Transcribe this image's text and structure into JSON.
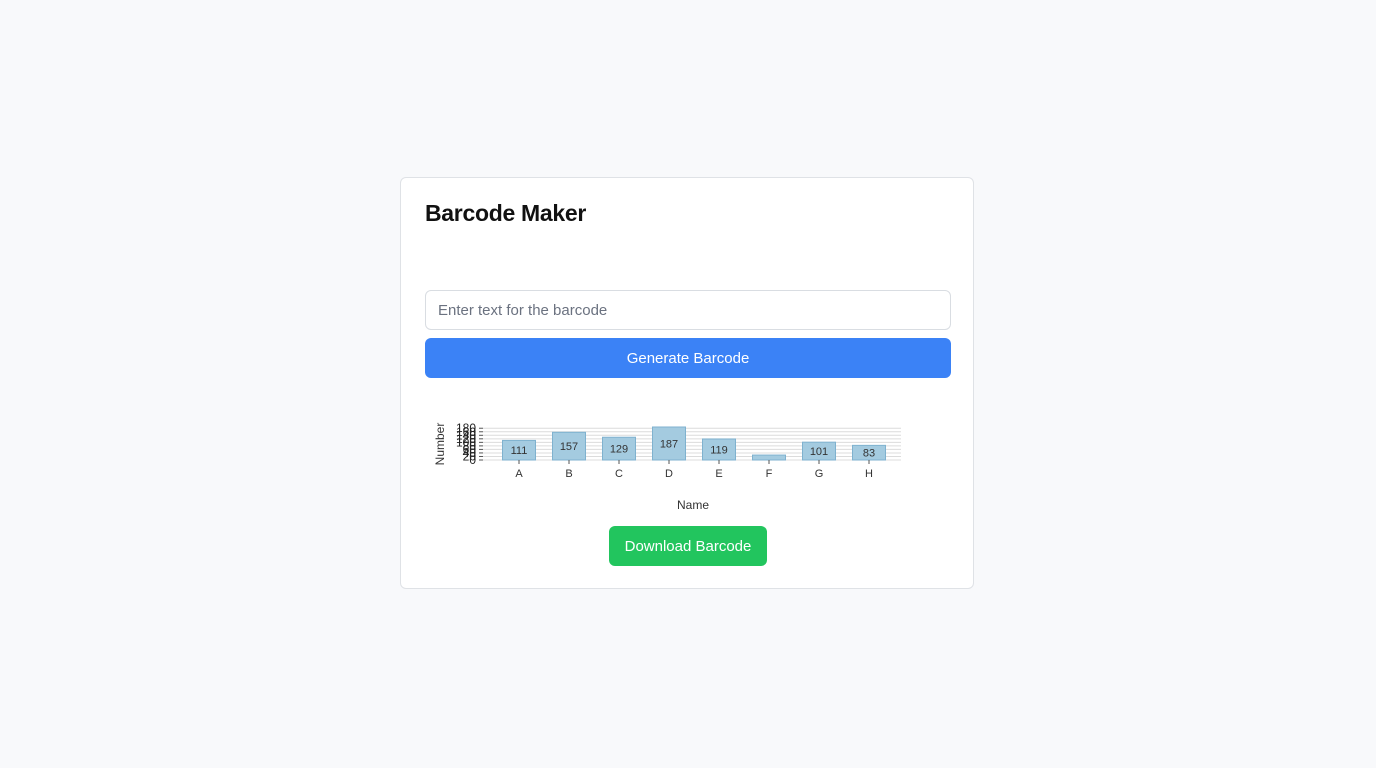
{
  "app": {
    "title": "Barcode Maker"
  },
  "form": {
    "input_value": "",
    "input_placeholder": "Enter text for the barcode",
    "generate_label": "Generate Barcode",
    "download_label": "Download Barcode"
  },
  "colors": {
    "primary": "#3b82f6",
    "success": "#22c55e",
    "bar_fill": "#a4cbe0",
    "bar_stroke": "#7fb2cf"
  },
  "chart_data": {
    "type": "bar",
    "categories": [
      "A",
      "B",
      "C",
      "D",
      "E",
      "F",
      "G",
      "H"
    ],
    "values": [
      111,
      157,
      129,
      187,
      119,
      28,
      101,
      83
    ],
    "xlabel": "Name",
    "ylabel": "Number",
    "ylim": [
      0,
      187
    ],
    "yticks": [
      0,
      20,
      40,
      60,
      80,
      100,
      120,
      140,
      160,
      180
    ],
    "grid": true
  }
}
